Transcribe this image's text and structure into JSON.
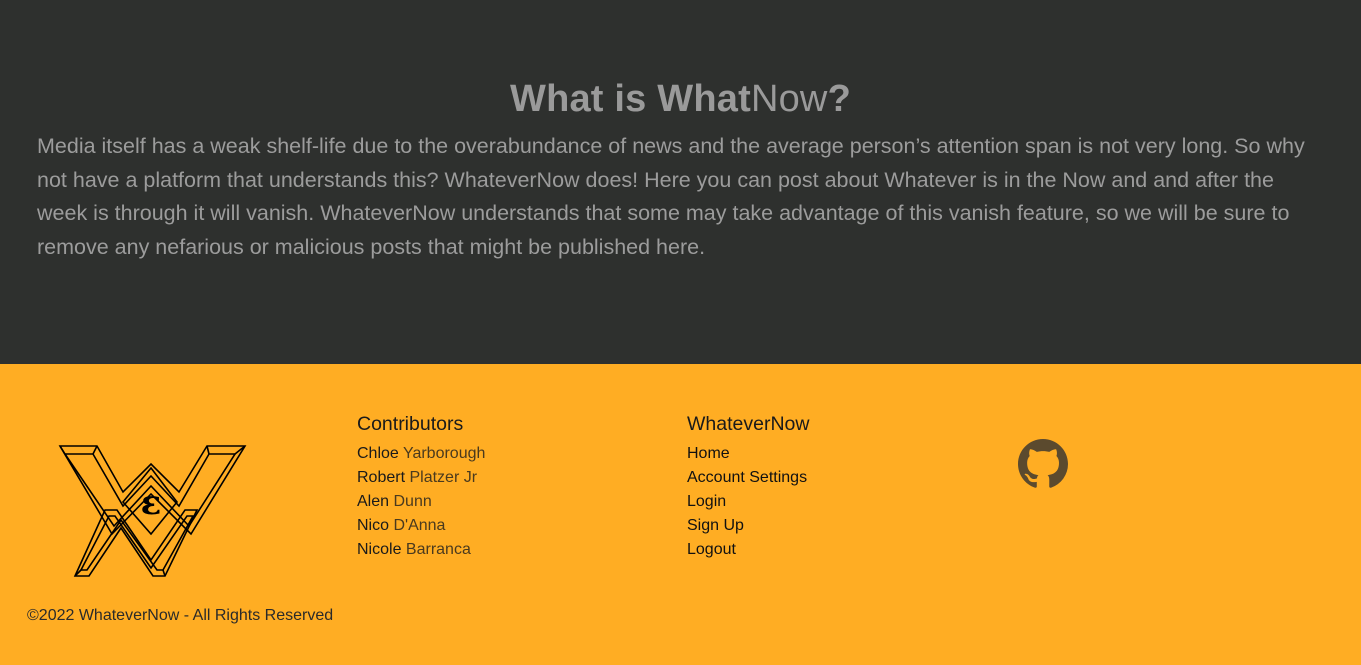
{
  "about": {
    "title_bold": "What is What",
    "title_thin": "Now",
    "title_end": "?",
    "text": "Media itself has a weak shelf-life due to the overabundance of news and the average person’s attention span is not very long. So why not have a platform that understands this? WhateverNow does! Here you can post about Whatever is in the Now and and after the week is through it will vanish. WhateverNow understands that some may take advantage of this vanish feature, so we will be sure to remove any nefarious or malicious posts that might be published here."
  },
  "footer": {
    "logo_icon": "whatevernow-logo-icon",
    "contributors": {
      "heading": "Contributors",
      "people": [
        {
          "first": "Chloe",
          "last": "Yarborough"
        },
        {
          "first": "Robert",
          "last": "Platzer Jr"
        },
        {
          "first": "Alen",
          "last": "Dunn"
        },
        {
          "first": "Nico",
          "last": "D'Anna"
        },
        {
          "first": "Nicole",
          "last": "Barranca"
        }
      ]
    },
    "nav": {
      "heading": "WhateverNow",
      "links": [
        "Home",
        "Account Settings",
        "Login",
        "Sign Up",
        "Logout"
      ]
    },
    "github_icon": "github-icon",
    "copyright": "©2022 WhateverNow - All Rights Reserved"
  },
  "colors": {
    "dark_bg": "#2e302e",
    "footer_bg": "#ffad23",
    "muted_text": "#9c9c9c"
  }
}
